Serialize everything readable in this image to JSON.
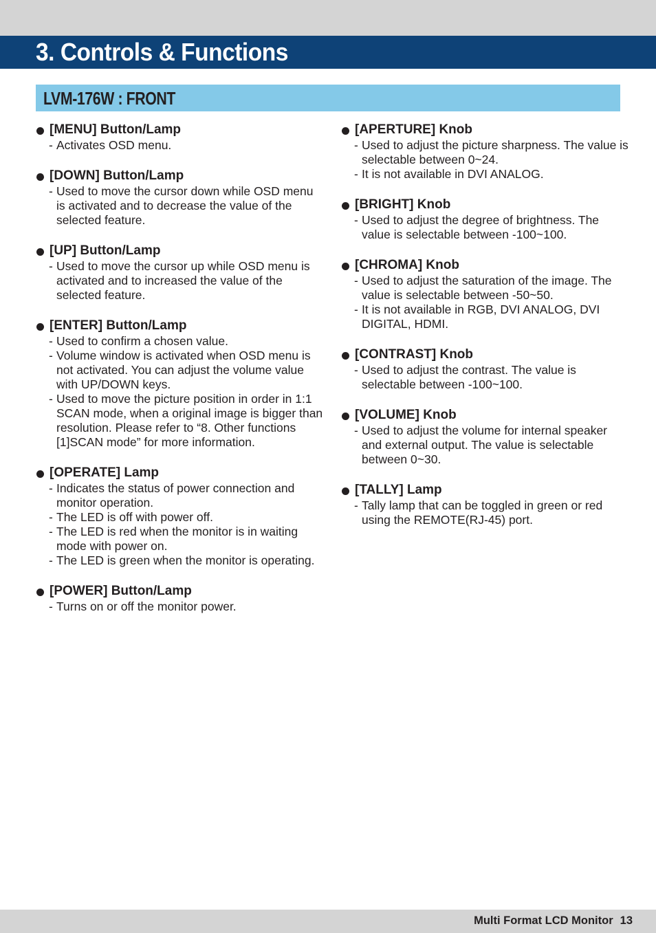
{
  "header": {
    "chapter_title": "3. Controls & Functions"
  },
  "section": {
    "title": "LVM-176W : FRONT"
  },
  "left_column": [
    {
      "title": "[MENU] Button/Lamp",
      "lines": [
        "Activates OSD menu."
      ]
    },
    {
      "title": "[DOWN] Button/Lamp",
      "lines": [
        "Used to move the cursor down while OSD menu is activated and to decrease the value of the selected feature."
      ]
    },
    {
      "title": "[UP] Button/Lamp",
      "lines": [
        "Used to move the cursor up while OSD menu is activated and to increased the value of the selected feature."
      ]
    },
    {
      "title": "[ENTER] Button/Lamp",
      "lines": [
        "Used to confirm a chosen value.",
        "Volume window is activated when OSD menu is not activated. You can adjust the volume value with UP/DOWN keys.",
        "Used to move the picture position in order in 1:1 SCAN mode, when a original image is bigger than resolution.  Please refer to “8. Other functions [1]SCAN mode” for more information."
      ]
    },
    {
      "title": "[OPERATE] Lamp",
      "lines": [
        "Indicates the status of power connection and monitor operation.",
        "The LED is off with power off.",
        "The LED is red when the monitor is in waiting mode with power on.",
        "The LED is green when the monitor is operating."
      ]
    },
    {
      "title": "[POWER] Button/Lamp",
      "lines": [
        "Turns on or off the monitor power."
      ]
    }
  ],
  "right_column": [
    {
      "title": "[APERTURE] Knob",
      "lines": [
        "Used to adjust the picture sharpness. The value is selectable between 0~24.",
        "It is not available in DVI ANALOG."
      ]
    },
    {
      "title": "[BRIGHT] Knob",
      "lines": [
        "Used to adjust the degree of brightness. The value is selectable between -100~100."
      ]
    },
    {
      "title": "[CHROMA] Knob",
      "lines": [
        "Used to adjust the saturation of the image. The value is selectable between -50~50.",
        "It is not available in RGB, DVI ANALOG, DVI DIGITAL, HDMI."
      ]
    },
    {
      "title": "[CONTRAST] Knob",
      "lines": [
        "Used to adjust the contrast. The value is selectable between -100~100."
      ]
    },
    {
      "title": "[VOLUME] Knob",
      "lines": [
        "Used to adjust the volume for internal speaker and external output. The value is selectable between 0~30."
      ]
    },
    {
      "title": "[TALLY] Lamp",
      "lines": [
        "Tally lamp that can be toggled in green or red using the REMOTE(RJ-45) port."
      ]
    }
  ],
  "footer": {
    "product_name": "Multi Format LCD Monitor",
    "page_number": "13"
  },
  "colors": {
    "header_band": "#0e4277",
    "section_bar": "#84c9e8",
    "gray_band": "#d4d4d4",
    "text": "#231f20"
  },
  "dash": "-"
}
